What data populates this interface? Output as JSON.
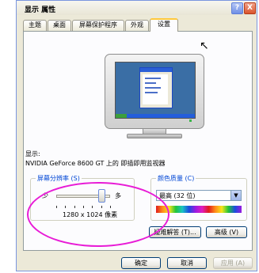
{
  "window": {
    "title": "显示 属性"
  },
  "title_buttons": {
    "help": "?",
    "close": "X"
  },
  "tabs": [
    {
      "label": "主题"
    },
    {
      "label": "桌面"
    },
    {
      "label": "屏幕保护程序"
    },
    {
      "label": "外观"
    },
    {
      "label": "设置",
      "active": true
    }
  ],
  "display": {
    "label": "显示:",
    "device": "NVIDIA GeForce 8600 GT 上的 即插即用监视器"
  },
  "resolution": {
    "group_label": "屏幕分辨率 (S)",
    "less": "少",
    "more": "多",
    "value": "1280 x 1024 像素",
    "slider_fraction": 0.85
  },
  "color_quality": {
    "group_label": "颜色质量 (C)",
    "selected": "最高 (32 位)"
  },
  "actions": {
    "troubleshoot": "疑难解答 (T)...",
    "advanced": "高级 (V)"
  },
  "footer": {
    "ok": "确定",
    "cancel": "取消",
    "apply": "应用 (A)"
  },
  "colors": {
    "annotation_ellipse": "#e81bd6",
    "group_label": "#0046d5"
  }
}
